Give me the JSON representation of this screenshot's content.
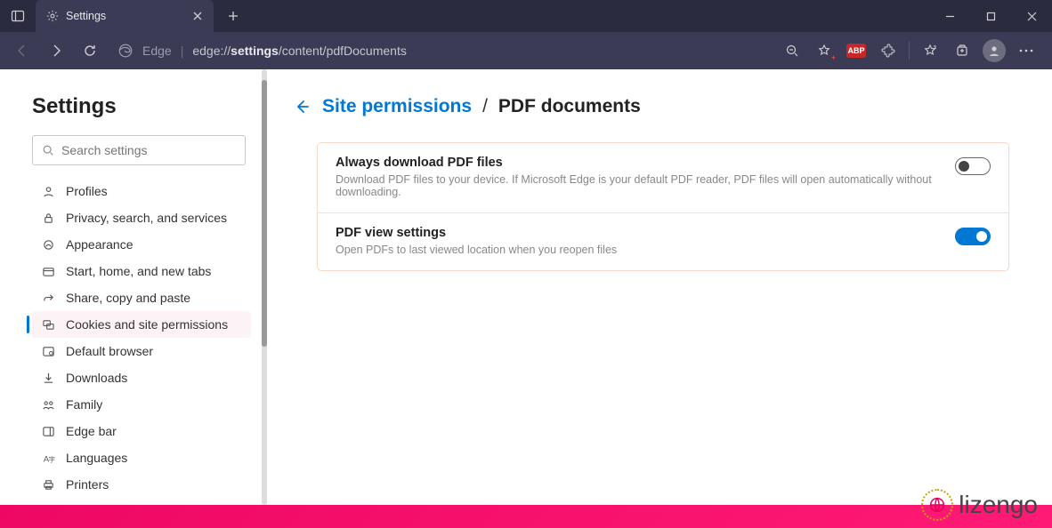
{
  "tab": {
    "title": "Settings"
  },
  "toolbar": {
    "site_label": "Edge",
    "url_prefix": "edge://",
    "url_bold": "settings",
    "url_suffix": "/content/pdfDocuments",
    "abp_label": "ABP"
  },
  "sidebar": {
    "title": "Settings",
    "search_placeholder": "Search settings",
    "items": [
      {
        "label": "Profiles"
      },
      {
        "label": "Privacy, search, and services"
      },
      {
        "label": "Appearance"
      },
      {
        "label": "Start, home, and new tabs"
      },
      {
        "label": "Share, copy and paste"
      },
      {
        "label": "Cookies and site permissions"
      },
      {
        "label": "Default browser"
      },
      {
        "label": "Downloads"
      },
      {
        "label": "Family"
      },
      {
        "label": "Edge bar"
      },
      {
        "label": "Languages"
      },
      {
        "label": "Printers"
      }
    ]
  },
  "breadcrumb": {
    "parent": "Site permissions",
    "separator": "/",
    "current": "PDF documents"
  },
  "settings": [
    {
      "title": "Always download PDF files",
      "description": "Download PDF files to your device. If Microsoft Edge is your default PDF reader, PDF files will open automatically without downloading.",
      "on": false
    },
    {
      "title": "PDF view settings",
      "description": "Open PDFs to last viewed location when you reopen files",
      "on": true
    }
  ],
  "watermark": {
    "text": "lizengo"
  }
}
